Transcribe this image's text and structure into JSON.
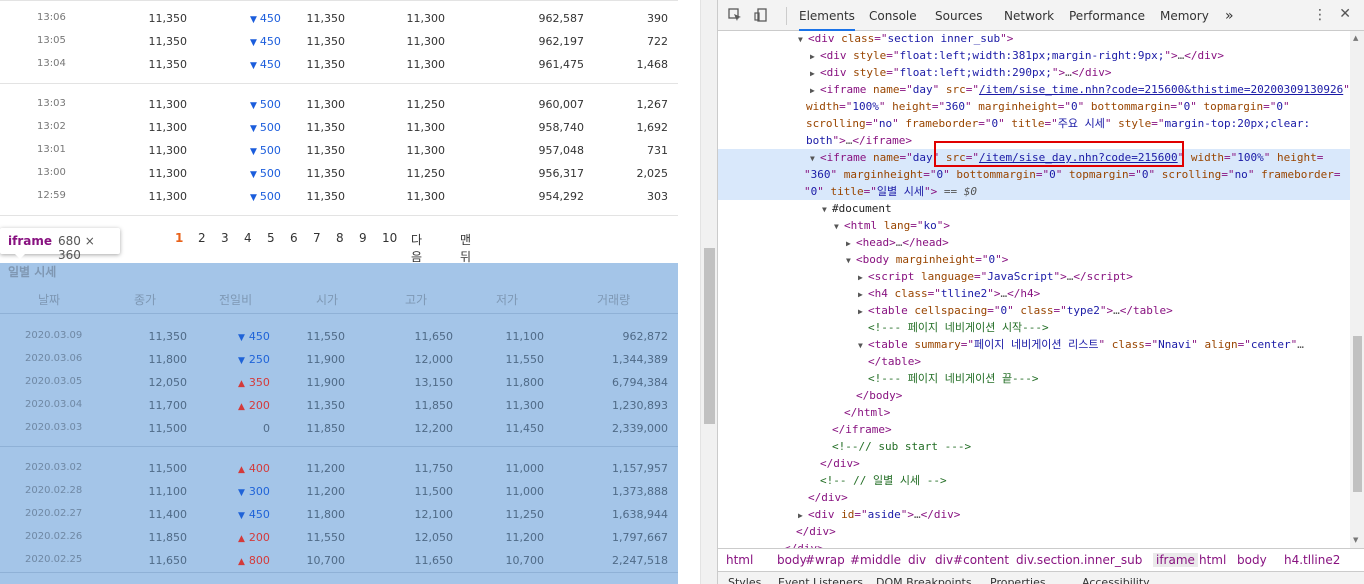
{
  "intraday_rows_top": [
    {
      "time": "13:06",
      "close": "11,350",
      "diff": "450",
      "buy": "11,350",
      "sell": "11,300",
      "volume": "962,587",
      "change": "390"
    },
    {
      "time": "13:05",
      "close": "11,350",
      "diff": "450",
      "buy": "11,350",
      "sell": "11,300",
      "volume": "962,197",
      "change": "722"
    },
    {
      "time": "13:04",
      "close": "11,350",
      "diff": "450",
      "buy": "11,350",
      "sell": "11,300",
      "volume": "961,475",
      "change": "1,468"
    }
  ],
  "intraday_rows_bottom": [
    {
      "time": "13:03",
      "close": "11,300",
      "diff": "500",
      "buy": "11,300",
      "sell": "11,250",
      "volume": "960,007",
      "change": "1,267"
    },
    {
      "time": "13:02",
      "close": "11,300",
      "diff": "500",
      "buy": "11,350",
      "sell": "11,300",
      "volume": "958,740",
      "change": "1,692"
    },
    {
      "time": "13:01",
      "close": "11,300",
      "diff": "500",
      "buy": "11,350",
      "sell": "11,300",
      "volume": "957,048",
      "change": "731"
    },
    {
      "time": "13:00",
      "close": "11,300",
      "diff": "500",
      "buy": "11,350",
      "sell": "11,250",
      "volume": "956,317",
      "change": "2,025"
    },
    {
      "time": "12:59",
      "close": "11,300",
      "diff": "500",
      "buy": "11,350",
      "sell": "11,300",
      "volume": "954,292",
      "change": "303"
    }
  ],
  "pager": {
    "pages": [
      "1",
      "2",
      "3",
      "4",
      "5",
      "6",
      "7",
      "8",
      "9",
      "10"
    ],
    "current": "1",
    "next": "다음",
    "last": "맨뒤"
  },
  "tooltip": {
    "tag": "iframe",
    "size": "680 × 360"
  },
  "daily": {
    "title": "일별 시세",
    "headers": [
      "날짜",
      "종가",
      "전일비",
      "시가",
      "고가",
      "저가",
      "거래량"
    ],
    "rows_top": [
      {
        "date": "2020.03.09",
        "close": "11,350",
        "dir": "down",
        "diff": "450",
        "open": "11,550",
        "high": "11,650",
        "low": "11,100",
        "volume": "962,872"
      },
      {
        "date": "2020.03.06",
        "close": "11,800",
        "dir": "down",
        "diff": "250",
        "open": "11,900",
        "high": "12,000",
        "low": "11,550",
        "volume": "1,344,389"
      },
      {
        "date": "2020.03.05",
        "close": "12,050",
        "dir": "up",
        "diff": "350",
        "open": "11,900",
        "high": "13,150",
        "low": "11,800",
        "volume": "6,794,384"
      },
      {
        "date": "2020.03.04",
        "close": "11,700",
        "dir": "up",
        "diff": "200",
        "open": "11,350",
        "high": "11,850",
        "low": "11,300",
        "volume": "1,230,893"
      },
      {
        "date": "2020.03.03",
        "close": "11,500",
        "dir": "flat",
        "diff": "0",
        "open": "11,850",
        "high": "12,200",
        "low": "11,450",
        "volume": "2,339,000"
      }
    ],
    "rows_bottom": [
      {
        "date": "2020.03.02",
        "close": "11,500",
        "dir": "up",
        "diff": "400",
        "open": "11,200",
        "high": "11,750",
        "low": "11,000",
        "volume": "1,157,957"
      },
      {
        "date": "2020.02.28",
        "close": "11,100",
        "dir": "down",
        "diff": "300",
        "open": "11,200",
        "high": "11,500",
        "low": "11,000",
        "volume": "1,373,888"
      },
      {
        "date": "2020.02.27",
        "close": "11,400",
        "dir": "down",
        "diff": "450",
        "open": "11,800",
        "high": "12,100",
        "low": "11,250",
        "volume": "1,638,944"
      },
      {
        "date": "2020.02.26",
        "close": "11,850",
        "dir": "up",
        "diff": "200",
        "open": "11,550",
        "high": "12,050",
        "low": "11,200",
        "volume": "1,797,667"
      },
      {
        "date": "2020.02.25",
        "close": "11,650",
        "dir": "up",
        "diff": "800",
        "open": "10,700",
        "high": "11,650",
        "low": "10,700",
        "volume": "2,247,518"
      }
    ]
  },
  "devtools": {
    "tabs": [
      "Elements",
      "Console",
      "Sources",
      "Network",
      "Performance",
      "Memory"
    ],
    "active_tab": "Elements",
    "more_tabs": "»",
    "tree_lines": [
      {
        "indent": 0,
        "arrow": "▼",
        "html": "&lt;div <span class=an>class</span>=\"<span class=av>section inner_sub</span>\"&gt;"
      },
      {
        "indent": 1,
        "arrow": "▶",
        "html": "&lt;div <span class=an>style</span>=\"<span class=av>float:left;width:381px;margin-right:9px;</span>\"&gt;<span class=ell>…</span>&lt;/div&gt;"
      },
      {
        "indent": 1,
        "arrow": "▶",
        "html": "&lt;div <span class=an>style</span>=\"<span class=av>float:left;width:290px;</span>\"&gt;<span class=ell>…</span>&lt;/div&gt;"
      },
      {
        "indent": 1,
        "arrow": "▶",
        "html": "&lt;iframe <span class=an>name</span>=\"<span class=av>day</span>\" <span class=an>src</span>=\"<span class=link>/item/sise_time.nhn?code=215600&amp;thistime=20200309130926</span>\""
      },
      {
        "indent": 1,
        "arrow": "",
        "html": "<span class=an>width</span>=\"<span class=av>100%</span>\" <span class=an>height</span>=\"<span class=av>360</span>\" <span class=an>marginheight</span>=\"<span class=av>0</span>\" <span class=an>bottommargin</span>=\"<span class=av>0</span>\" <span class=an>topmargin</span>=\"<span class=av>0</span>\""
      },
      {
        "indent": 1,
        "arrow": "",
        "html": "<span class=an>scrolling</span>=\"<span class=av>no</span>\" <span class=an>frameborder</span>=\"<span class=av>0</span>\" <span class=an>title</span>=\"<span class=av>주요 시세</span>\" <span class=an>style</span>=\"<span class=av>margin-top:20px;clear:</span>"
      },
      {
        "indent": 1,
        "arrow": "",
        "html": "<span class=av>both</span>\"&gt;<span class=ell>…</span>&lt;/iframe&gt;"
      },
      {
        "indent": 1,
        "arrow": "▼",
        "sel": true,
        "html": "&lt;iframe <span class=an>name</span>=\"<span class=av>day</span>\" <span class=an>src</span>=\"<span class=link>/item/sise_day.nhn?code=215600</span>\" <span class=an>width</span>=\"<span class=av>100%</span>\" <span class=an>height</span>="
      },
      {
        "indent": 1,
        "arrow": "",
        "sel": true,
        "html": "\"<span class=av>360</span>\" <span class=an>marginheight</span>=\"<span class=av>0</span>\" <span class=an>bottommargin</span>=\"<span class=av>0</span>\" <span class=an>topmargin</span>=\"<span class=av>0</span>\" <span class=an>scrolling</span>=\"<span class=av>no</span>\" <span class=an>frameborder</span>="
      },
      {
        "indent": 1,
        "arrow": "",
        "sel": true,
        "html": "\"<span class=av>0</span>\" <span class=an>title</span>=\"<span class=av>일별 시세</span>\"&gt; <span class=eq>== $0</span>"
      },
      {
        "indent": 2,
        "arrow": "▼",
        "html": "<span class=tx>#document</span>"
      },
      {
        "indent": 3,
        "arrow": "▼",
        "html": "&lt;html <span class=an>lang</span>=\"<span class=av>ko</span>\"&gt;"
      },
      {
        "indent": 4,
        "arrow": "▶",
        "html": "&lt;head&gt;<span class=ell>…</span>&lt;/head&gt;"
      },
      {
        "indent": 4,
        "arrow": "▼",
        "html": "&lt;body <span class=an>marginheight</span>=\"<span class=av>0</span>\"&gt;"
      },
      {
        "indent": 5,
        "arrow": "▶",
        "html": "&lt;script <span class=an>language</span>=\"<span class=av>JavaScript</span>\"&gt;<span class=ell>…</span>&lt;/script&gt;"
      },
      {
        "indent": 5,
        "arrow": "▶",
        "html": "&lt;h4 <span class=an>class</span>=\"<span class=av>tlline2</span>\"&gt;<span class=ell>…</span>&lt;/h4&gt;"
      },
      {
        "indent": 5,
        "arrow": "▶",
        "html": "&lt;table <span class=an>cellspacing</span>=\"<span class=av>0</span>\" <span class=an>class</span>=\"<span class=av>type2</span>\"&gt;<span class=ell>…</span>&lt;/table&gt;"
      },
      {
        "indent": 5,
        "arrow": "",
        "html": "<span class=cm>&lt;!--- 페이지 네비게이션 시작---&gt;</span>"
      },
      {
        "indent": 5,
        "arrow": "▼",
        "html": "&lt;table <span class=an>summary</span>=\"<span class=av>페이지 네비게이션 리스트</span>\" <span class=an>class</span>=\"<span class=av>Nnavi</span>\" <span class=an>align</span>=\"<span class=av>center</span>\"<span class=ell>…</span>"
      },
      {
        "indent": 5,
        "arrow": "",
        "html": "&lt;/table&gt;"
      },
      {
        "indent": 5,
        "arrow": "",
        "html": "<span class=cm>&lt;!--- 페이지 네비게이션 끝---&gt;</span>"
      },
      {
        "indent": 4,
        "arrow": "",
        "html": "&lt;/body&gt;"
      },
      {
        "indent": 3,
        "arrow": "",
        "html": "&lt;/html&gt;"
      },
      {
        "indent": 2,
        "arrow": "",
        "html": "&lt;/iframe&gt;"
      },
      {
        "indent": 2,
        "arrow": "",
        "html": "<span class=cm>&lt;!--// sub start ---&gt;</span>"
      },
      {
        "indent": 1,
        "arrow": "",
        "html": "&lt;/div&gt;"
      },
      {
        "indent": 1,
        "arrow": "",
        "html": "<span class=cm>&lt;!-- // 일별 시세 --&gt;</span>"
      },
      {
        "indent": 0,
        "arrow": "",
        "html": "&lt;/div&gt;"
      },
      {
        "indent": 0,
        "arrow": "▶",
        "html": "&lt;div <span class=an>id</span>=\"<span class=av>aside</span>\"&gt;<span class=ell>…</span>&lt;/div&gt;"
      },
      {
        "indent": -1,
        "arrow": "",
        "html": "&lt;/div&gt;"
      },
      {
        "indent": -2,
        "arrow": "",
        "html": "&lt;/div&gt;"
      }
    ],
    "breadcrumbs": [
      "html",
      "body",
      "#wrap",
      "#middle",
      "div",
      "div#content",
      "div.section.inner_sub",
      "iframe",
      "html",
      "body",
      "h4.tlline2"
    ],
    "breadcrumb_active": "iframe",
    "bottom_tabs": [
      "Styles",
      "Event Listeners",
      "DOM Breakpoints",
      "Properties",
      "Accessibility"
    ]
  }
}
